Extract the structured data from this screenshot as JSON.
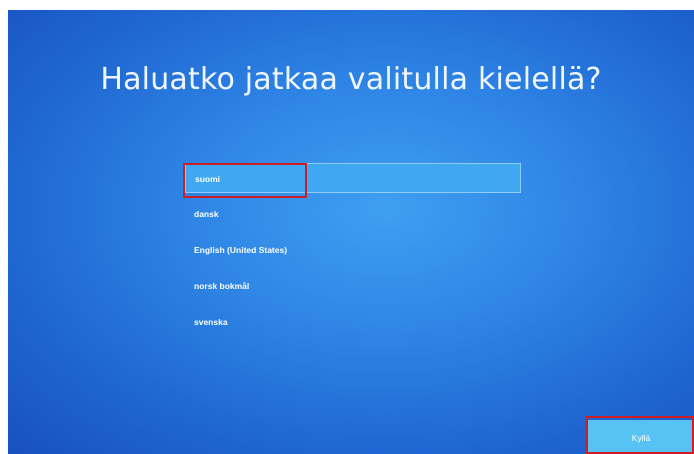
{
  "heading": "Haluatko jatkaa valitulla kielellä?",
  "languages": [
    {
      "label": "suomi",
      "selected": true
    },
    {
      "label": "dansk",
      "selected": false
    },
    {
      "label": "English (United States)",
      "selected": false
    },
    {
      "label": "norsk bokmål",
      "selected": false
    },
    {
      "label": "svenska",
      "selected": false
    }
  ],
  "next_button": {
    "label": "Kyllä"
  },
  "colors": {
    "background": "#2f86e6",
    "selected_item": "#3ea8f2",
    "button": "#57c3f4",
    "highlight_box": "#cc1f24"
  }
}
